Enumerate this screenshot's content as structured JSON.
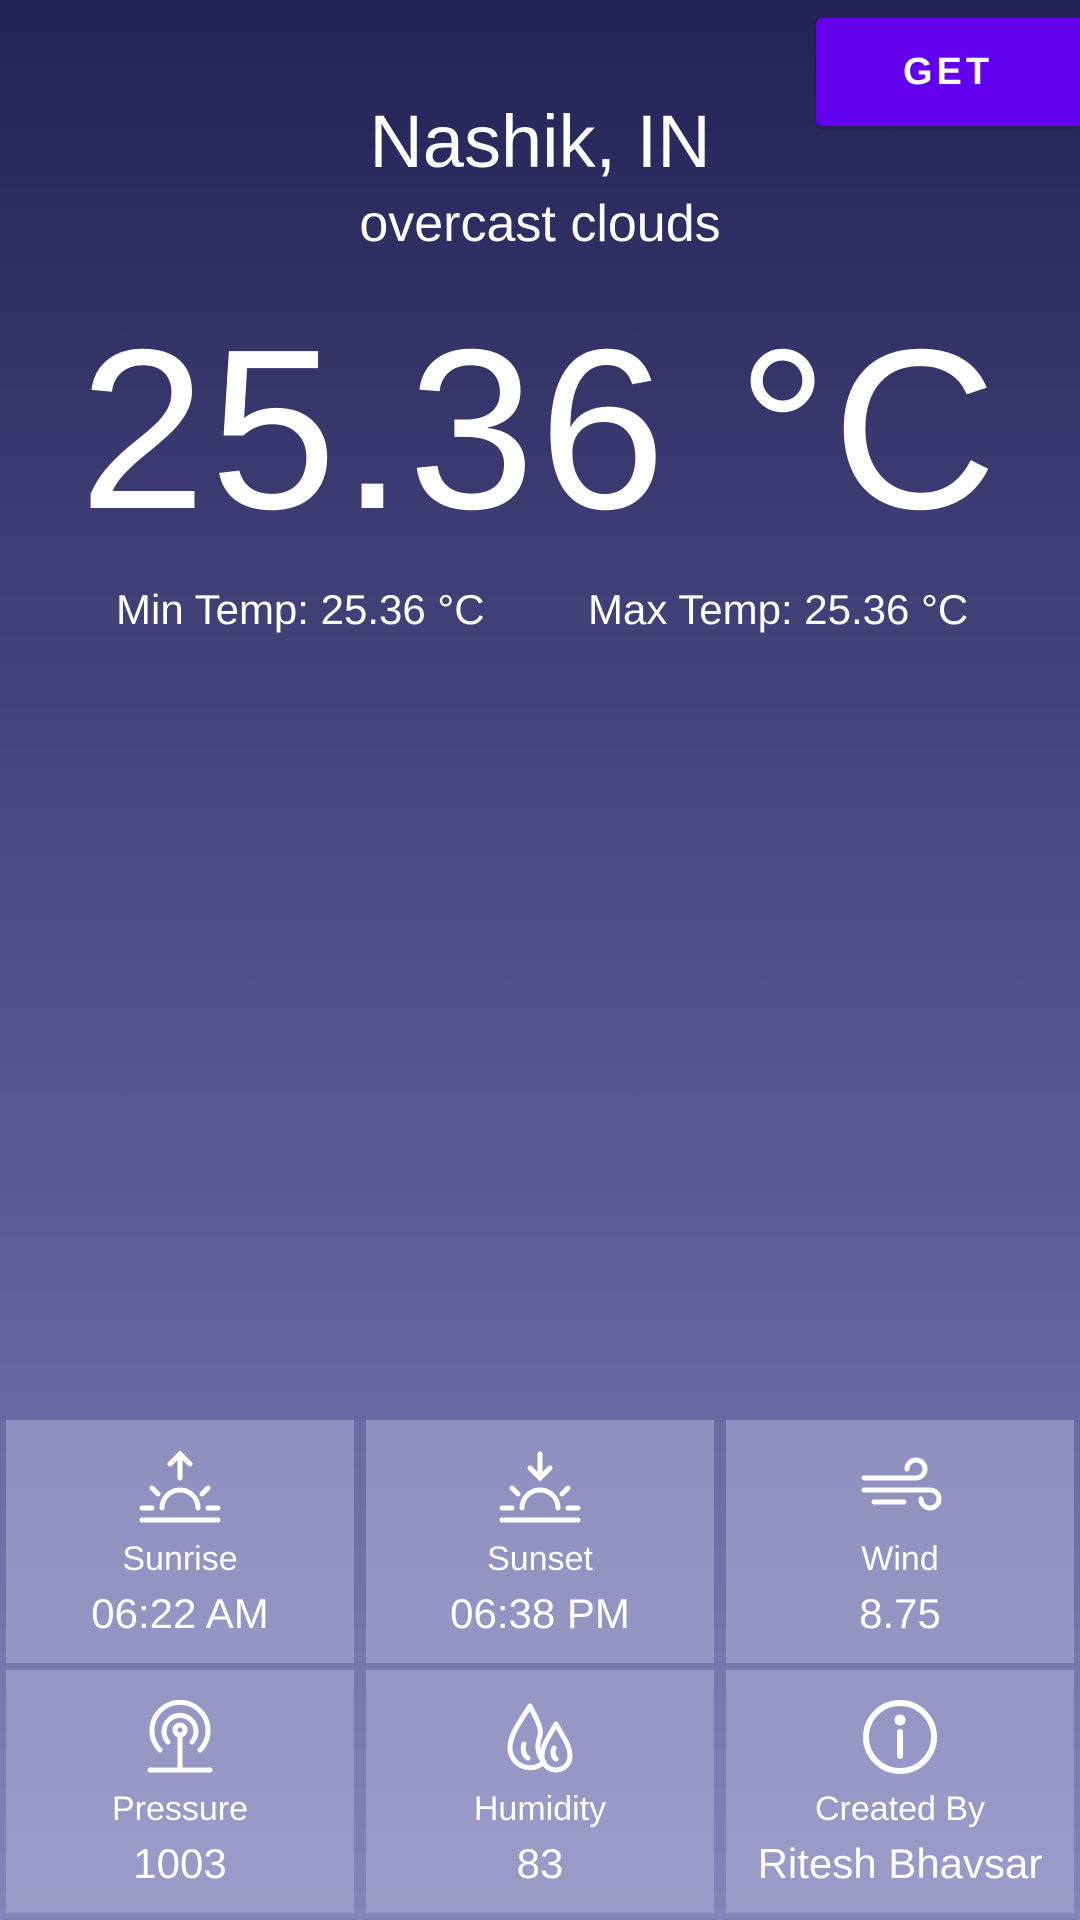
{
  "header": {
    "get_label": "GET"
  },
  "weather": {
    "location": "Nashik, IN",
    "description": "overcast clouds",
    "temperature": "25.36 °C",
    "min_temp": "Min Temp: 25.36 °C",
    "max_temp": "Max Temp: 25.36 °C"
  },
  "details": [
    {
      "label": "Sunrise",
      "value": "06:22 AM",
      "icon": "sunrise-icon"
    },
    {
      "label": "Sunset",
      "value": "06:38 PM",
      "icon": "sunset-icon"
    },
    {
      "label": "Wind",
      "value": "8.75",
      "icon": "wind-icon"
    },
    {
      "label": "Pressure",
      "value": "1003",
      "icon": "pressure-gauge-icon"
    },
    {
      "label": "Humidity",
      "value": "83",
      "icon": "humidity-drops-icon"
    },
    {
      "label": "Created By",
      "value": "Ritesh Bhavsar",
      "icon": "info-icon"
    }
  ],
  "colors": {
    "accent": "#6200ee",
    "background_top": "#222255",
    "background_bottom": "#8484b8",
    "text": "#ffffff"
  }
}
